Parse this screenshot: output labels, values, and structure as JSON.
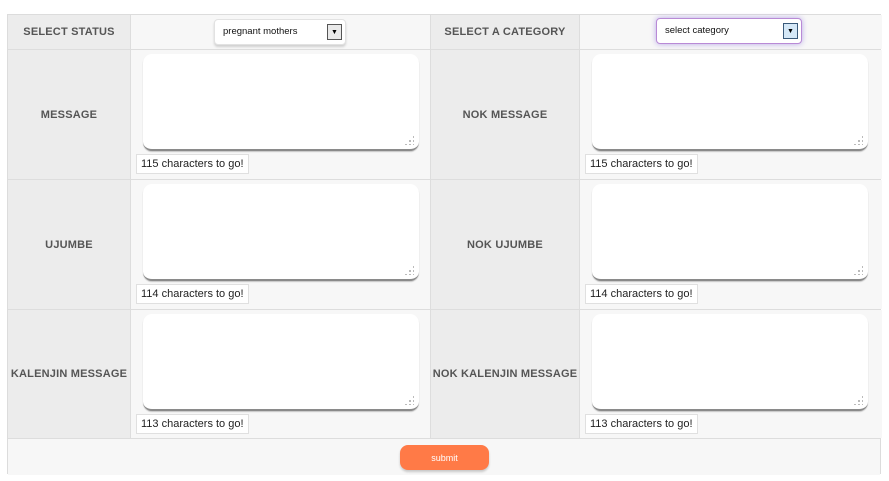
{
  "header": {
    "status_label": "SELECT STATUS",
    "status_value": "pregnant mothers",
    "category_label": "SELECT A CATEGORY",
    "category_value": "select category"
  },
  "rows": [
    {
      "left_label": "MESSAGE",
      "left_counter": "115 characters to go!",
      "right_label": "NOK MESSAGE",
      "right_counter": "115 characters to go!"
    },
    {
      "left_label": "UJUMBE",
      "left_counter": "114 characters to go!",
      "right_label": "NOK UJUMBE",
      "right_counter": "114 characters to go!"
    },
    {
      "left_label": "KALENJIN MESSAGE",
      "left_counter": "113 characters to go!",
      "right_label": "NOK KALENJIN MESSAGE",
      "right_counter": "113 characters to go!"
    }
  ],
  "footer": {
    "submit_label": "submit"
  },
  "colors": {
    "submit": "#ff7a47",
    "label_bg": "#ececec",
    "focus_border": "#b98ad6"
  },
  "icons": {
    "dropdown": "chevron-down-icon",
    "resize": "resize-grip-icon"
  }
}
